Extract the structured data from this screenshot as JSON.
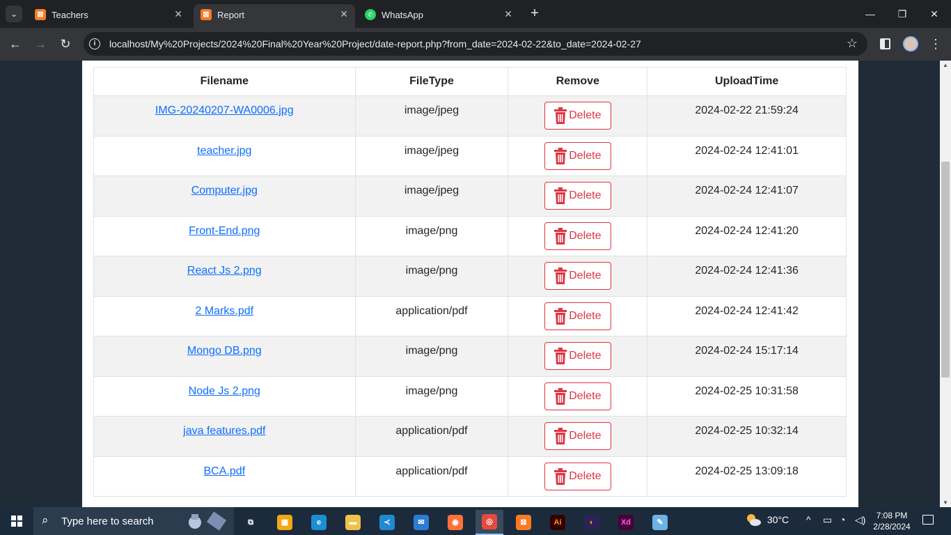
{
  "browser": {
    "tabs": [
      {
        "label": "Teachers",
        "favicon": "xampp-icon",
        "active": false
      },
      {
        "label": "Report",
        "favicon": "xampp-icon",
        "active": true
      },
      {
        "label": "WhatsApp",
        "favicon": "whatsapp-icon",
        "active": false
      }
    ],
    "url": "localhost/My%20Projects/2024%20Final%20Year%20Project/date-report.php?from_date=2024-02-22&to_date=2024-02-27"
  },
  "table": {
    "headers": [
      "Filename",
      "FileType",
      "Remove",
      "UploadTime"
    ],
    "delete_label": "Delete",
    "rows": [
      {
        "filename": "IMG-20240207-WA0006.jpg",
        "filetype": "image/jpeg",
        "upload_time": "2024-02-22 21:59:24"
      },
      {
        "filename": "teacher.jpg",
        "filetype": "image/jpeg",
        "upload_time": "2024-02-24 12:41:01"
      },
      {
        "filename": "Computer.jpg",
        "filetype": "image/jpeg",
        "upload_time": "2024-02-24 12:41:07"
      },
      {
        "filename": "Front-End.png",
        "filetype": "image/png",
        "upload_time": "2024-02-24 12:41:20"
      },
      {
        "filename": "React Js 2.png",
        "filetype": "image/png",
        "upload_time": "2024-02-24 12:41:36"
      },
      {
        "filename": "2 Marks.pdf",
        "filetype": "application/pdf",
        "upload_time": "2024-02-24 12:41:42"
      },
      {
        "filename": "Mongo DB.png",
        "filetype": "image/png",
        "upload_time": "2024-02-24 15:17:14"
      },
      {
        "filename": "Node Js 2.png",
        "filetype": "image/png",
        "upload_time": "2024-02-25 10:31:58"
      },
      {
        "filename": "java features.pdf",
        "filetype": "application/pdf",
        "upload_time": "2024-02-25 10:32:14"
      },
      {
        "filename": "BCA.pdf",
        "filetype": "application/pdf",
        "upload_time": "2024-02-25 13:09:18"
      }
    ],
    "colors": {
      "link": "#0d6efd",
      "danger": "#dc3545",
      "stripe": "#f2f2f2"
    }
  },
  "taskbar": {
    "search_placeholder": "Type here to search",
    "apps": [
      "task-view-icon",
      "microsoft-store-icon",
      "edge-icon",
      "file-explorer-icon",
      "vscode-icon",
      "mail-icon",
      "firefox-icon",
      "chrome-icon",
      "xampp-icon",
      "illustrator-icon",
      "eclipse-icon",
      "xd-icon",
      "notepad-icon"
    ],
    "weather": "30°C",
    "time": "7:08 PM",
    "date": "2/28/2024"
  }
}
